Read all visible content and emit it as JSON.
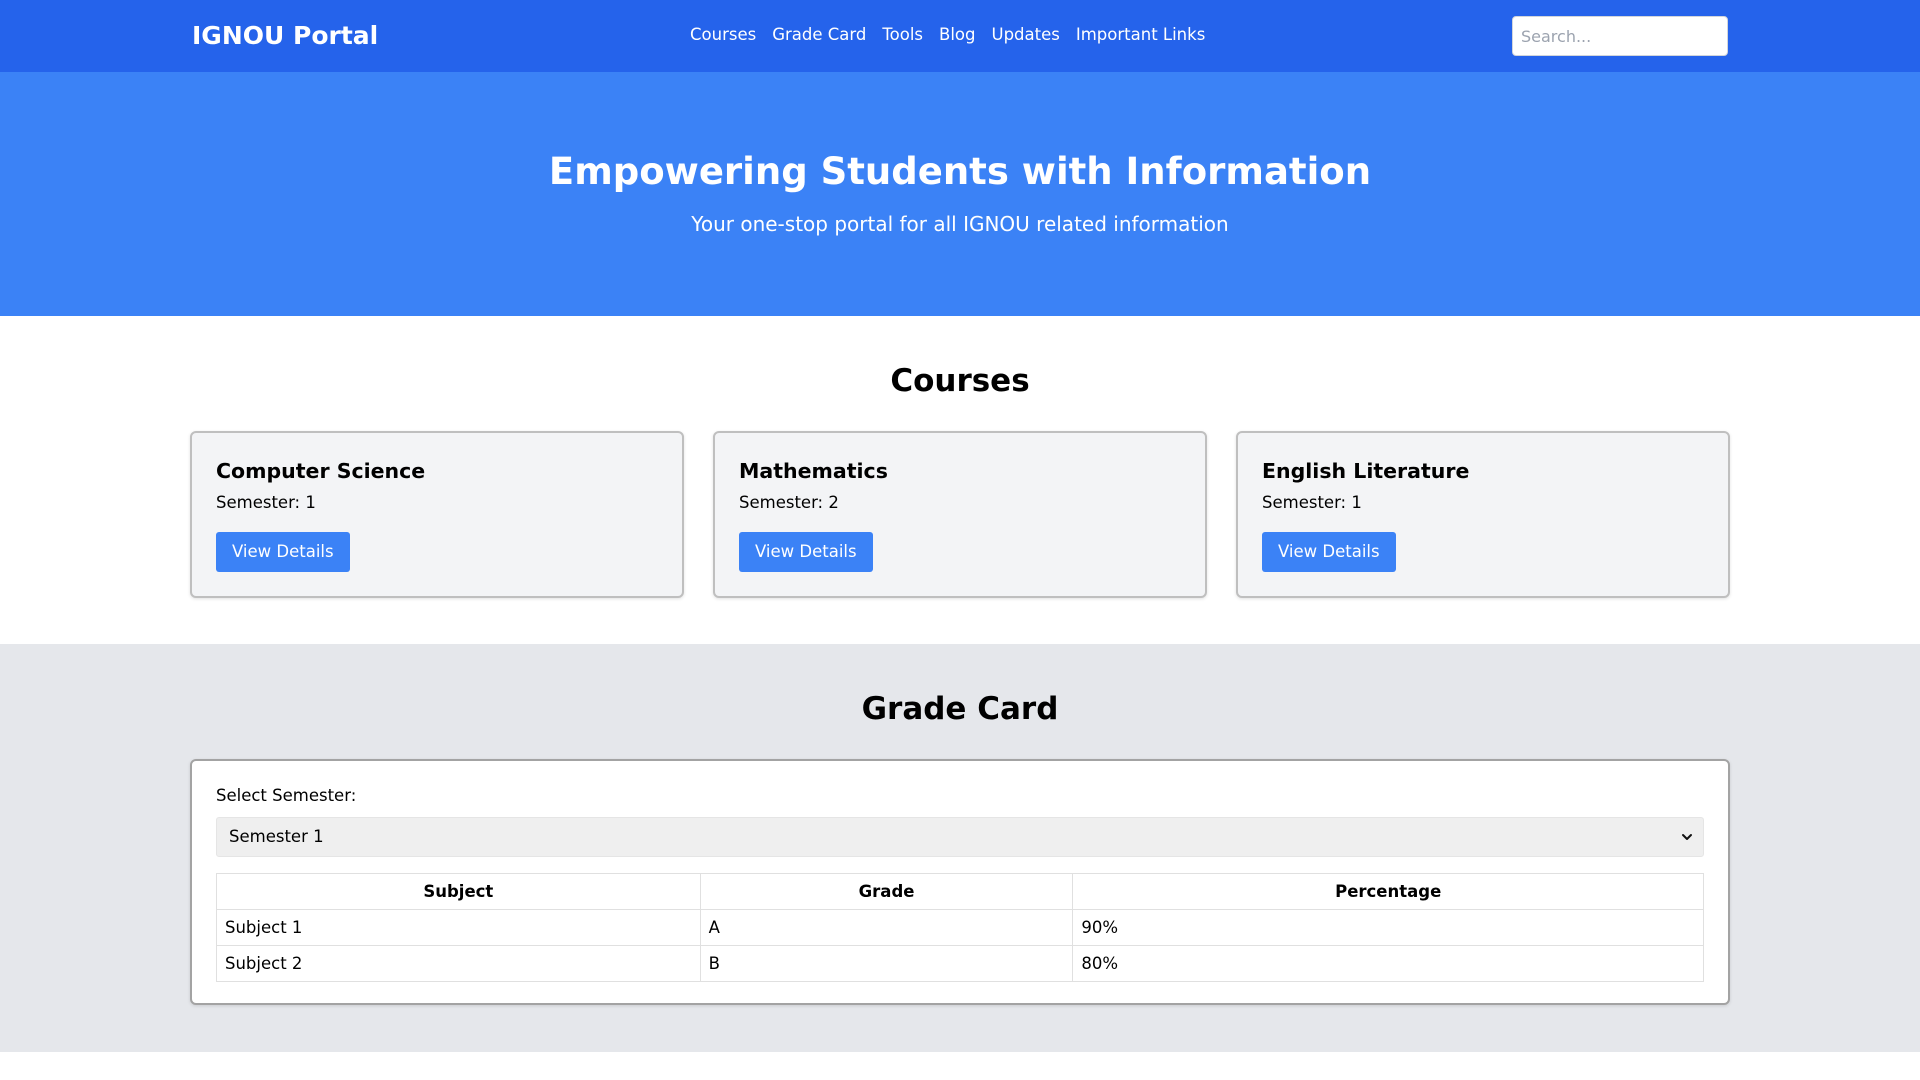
{
  "navbar": {
    "brand": "IGNOU Portal",
    "links": [
      "Courses",
      "Grade Card",
      "Tools",
      "Blog",
      "Updates",
      "Important Links"
    ],
    "search_placeholder": "Search..."
  },
  "hero": {
    "title": "Empowering Students with Information",
    "subtitle": "Your one-stop portal for all IGNOU related information"
  },
  "courses": {
    "title": "Courses",
    "items": [
      {
        "name": "Computer Science",
        "semester": "Semester: 1",
        "button": "View Details"
      },
      {
        "name": "Mathematics",
        "semester": "Semester: 2",
        "button": "View Details"
      },
      {
        "name": "English Literature",
        "semester": "Semester: 1",
        "button": "View Details"
      }
    ]
  },
  "grade_card": {
    "title": "Grade Card",
    "select_label": "Select Semester:",
    "selected_semester": "Semester 1",
    "table": {
      "headers": [
        "Subject",
        "Grade",
        "Percentage"
      ],
      "rows": [
        [
          "Subject 1",
          "A",
          "90%"
        ],
        [
          "Subject 2",
          "B",
          "80%"
        ]
      ]
    }
  },
  "colors": {
    "navbar": "#2563eb",
    "hero": "#3b82f6",
    "button": "#3b82f6",
    "grade_section_bg": "#e5e7eb"
  }
}
